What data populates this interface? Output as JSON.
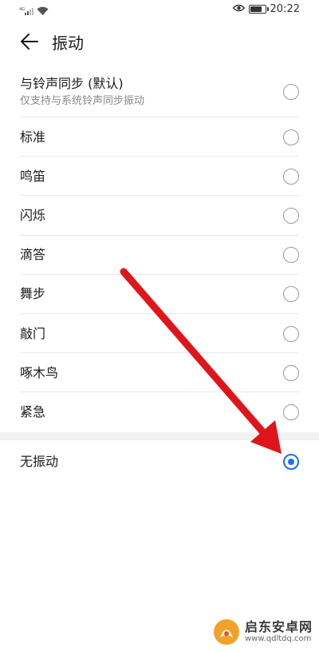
{
  "status_bar": {
    "signal_label": "4G",
    "time": "20:22",
    "battery_level": 0.85
  },
  "header": {
    "title": "振动"
  },
  "options": [
    {
      "label": "与铃声同步 (默认)",
      "sublabel": "仅支持与系统铃声同步振动",
      "selected": false
    },
    {
      "label": "标准",
      "selected": false
    },
    {
      "label": "鸣笛",
      "selected": false
    },
    {
      "label": "闪烁",
      "selected": false
    },
    {
      "label": "滴答",
      "selected": false
    },
    {
      "label": "舞步",
      "selected": false
    },
    {
      "label": "敲门",
      "selected": false
    },
    {
      "label": "啄木鸟",
      "selected": false
    },
    {
      "label": "紧急",
      "selected": false
    }
  ],
  "no_vibration": {
    "label": "无振动",
    "selected": true
  },
  "colors": {
    "accent": "#1a73e8",
    "annotation_arrow": "#e0151b"
  },
  "watermark": {
    "name": "启东安卓网",
    "url": "www.qdltdq.com"
  },
  "icons": {
    "back": "arrow-left-icon",
    "signal": "signal-icon",
    "wifi": "wifi-icon",
    "eye": "eye-icon",
    "battery": "battery-icon"
  }
}
